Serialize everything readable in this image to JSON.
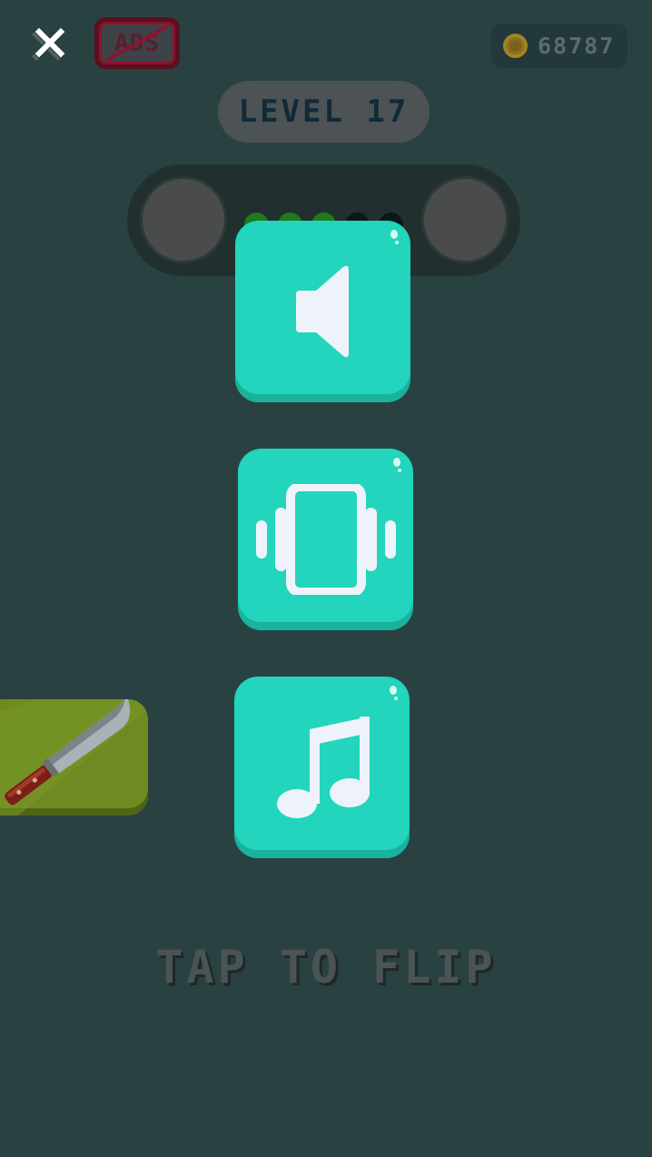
{
  "header": {
    "ads_label": "ADS",
    "coins": "68787"
  },
  "level": {
    "label": "LEVEL 17"
  },
  "progress": {
    "dots": [
      {
        "state": "completed",
        "color": "#1f7a1d"
      },
      {
        "state": "completed",
        "color": "#1f7a1d"
      },
      {
        "state": "completed",
        "color": "#1f7a1d"
      },
      {
        "state": "pending",
        "color": "#0c1718"
      },
      {
        "state": "pending",
        "color": "#0c1718"
      }
    ]
  },
  "settings": {
    "sound_icon": "speaker-icon",
    "vibration_icon": "vibrate-phone-icon",
    "music_icon": "music-note-icon"
  },
  "footer": {
    "tap_text": "TAP TO FLIP"
  },
  "colors": {
    "background": "#2a4142",
    "tile": "#22d5bc",
    "tile_shadow": "#19b29c",
    "icon": "#eef3fb",
    "ads_frame": "#8a1430",
    "card": "#6e8a21"
  }
}
